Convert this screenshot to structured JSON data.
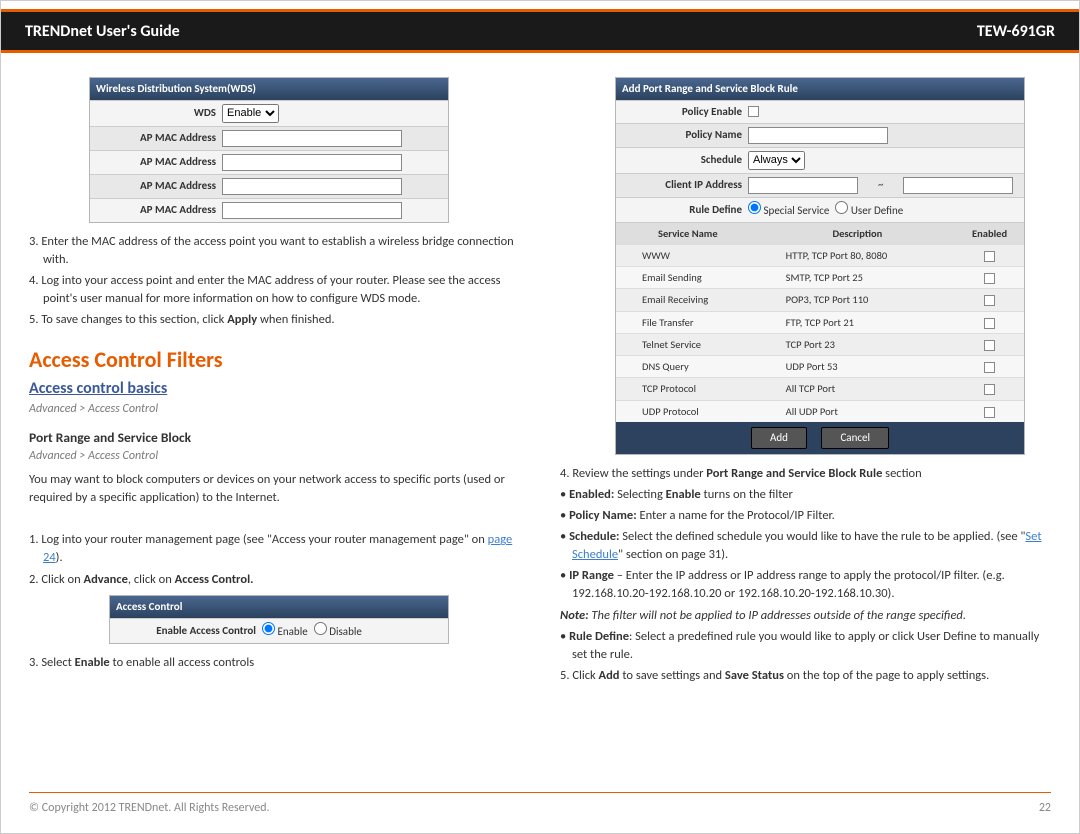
{
  "header": {
    "left": "TRENDnet User's Guide",
    "right": "TEW-691GR"
  },
  "left_col": {
    "wds_panel": {
      "title": "Wireless Distribution System(WDS)",
      "wds_label": "WDS",
      "wds_value": "Enable",
      "mac_label": "AP MAC Address"
    },
    "steps_a": [
      "3. Enter the MAC address of the access point you want to establish a wireless bridge connection with.",
      "4. Log into your access point and enter the MAC address of your router. Please see the access point's user manual for more information on how to configure WDS mode."
    ],
    "step5_pre": "5. To save changes to this section, click ",
    "step5_bold": "Apply",
    "step5_post": " when finished.",
    "section_title": "Access Control Filters",
    "sub_title": "Access control basics",
    "crumb1": "Advanced > Access Control",
    "sub_title2": "Port Range and Service Block",
    "crumb2": "Advanced > Access Control",
    "portblock_intro": "You may want to block computers or devices on your network access to specific ports (used or required by a specific application) to the Internet.",
    "step_b1_pre": "1. Log into your router management page (see \"Access your router management page\" on ",
    "step_b1_link": "page 24",
    "step_b1_post": ").",
    "step_b2_pre": "2. Click on ",
    "step_b2_b1": "Advance",
    "step_b2_mid": ", click on ",
    "step_b2_b2": "Access Control.",
    "ac_panel": {
      "title": "Access Control",
      "label": "Enable Access Control",
      "opt_enable": "Enable",
      "opt_disable": "Disable"
    },
    "step_b3_pre": "3. Select ",
    "step_b3_b": "Enable",
    "step_b3_post": " to enable all access controls"
  },
  "right_col": {
    "panel": {
      "title": "Add Port Range and Service Block Rule",
      "rows": {
        "policy_enable": "Policy Enable",
        "policy_name": "Policy Name",
        "schedule": "Schedule",
        "schedule_value": "Always",
        "client_ip": "Client IP Address",
        "tilde": "~",
        "rule_define": "Rule Define",
        "opt_special": "Special Service",
        "opt_user": "User Define"
      },
      "svc_headers": {
        "name": "Service Name",
        "desc": "Description",
        "enabled": "Enabled"
      },
      "services": [
        {
          "name": "WWW",
          "desc": "HTTP, TCP Port 80, 8080"
        },
        {
          "name": "Email Sending",
          "desc": "SMTP, TCP Port 25"
        },
        {
          "name": "Email Receiving",
          "desc": "POP3, TCP Port 110"
        },
        {
          "name": "File Transfer",
          "desc": "FTP, TCP Port 21"
        },
        {
          "name": "Telnet Service",
          "desc": "TCP Port 23"
        },
        {
          "name": "DNS Query",
          "desc": "UDP Port 53"
        },
        {
          "name": "TCP Protocol",
          "desc": "All TCP Port"
        },
        {
          "name": "UDP Protocol",
          "desc": "All UDP Port"
        }
      ],
      "btn_add": "Add",
      "btn_cancel": "Cancel"
    },
    "step4_pre": "4. Review the settings under ",
    "step4_b": "Port Range and Service Block Rule",
    "step4_post": " section",
    "bul_enabled_b": "Enabled:",
    "bul_enabled_1": " Selecting ",
    "bul_enabled_b2": "Enable",
    "bul_enabled_2": " turns on the filter",
    "bul_policy_b": "Policy Name:",
    "bul_policy_t": " Enter a name for the Protocol/IP Filter.",
    "bul_schedule_b": "Schedule:",
    "bul_schedule_t1": " Select the defined schedule you would like to have the rule to be applied. (see \"",
    "bul_schedule_link": "Set Schedule",
    "bul_schedule_t2": "\" section on page 31).",
    "bul_ip_b": "IP Range",
    "bul_ip_t": " – Enter the IP address or IP address range to apply the protocol/IP filter. (e.g. 192.168.10.20-192.168.10.20 or 192.168.10.20-192.168.10.30).",
    "note_b": "Note:",
    "note_t": " The filter will not be applied to IP addresses outside of the range specified.",
    "bul_rule_b": "Rule Define",
    "bul_rule_t": ": Select a predefined rule you would like to apply or click User Define to manually set the rule.",
    "step5_pre": "5. Click ",
    "step5_b1": "Add",
    "step5_mid": " to save settings and ",
    "step5_b2": "Save Status",
    "step5_post": " on the top of the page to apply settings."
  },
  "footer": {
    "copyright": "© Copyright 2012 TRENDnet. All Rights Reserved.",
    "pagenum": "22"
  }
}
